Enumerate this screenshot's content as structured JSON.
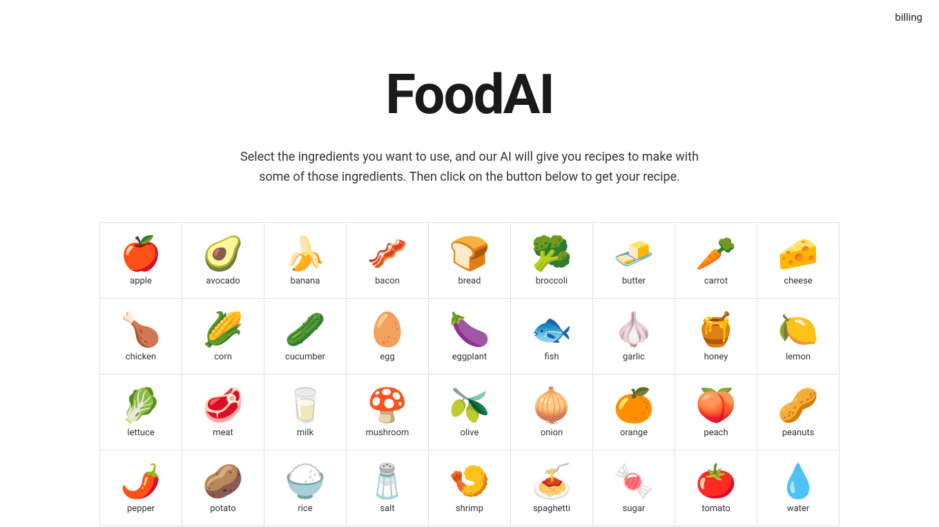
{
  "nav": {
    "billing_label": "billing"
  },
  "hero": {
    "title": "FoodAI",
    "subtitle": "Select the ingredients you want to use, and our AI will give you recipes to make with some of those ingredients. Then click on the button below to get your recipe."
  },
  "ingredients": [
    {
      "id": "apple",
      "label": "apple",
      "emoji": "🍎"
    },
    {
      "id": "avocado",
      "label": "avocado",
      "emoji": "🥑"
    },
    {
      "id": "banana",
      "label": "banana",
      "emoji": "🍌"
    },
    {
      "id": "bacon",
      "label": "bacon",
      "emoji": "🥓"
    },
    {
      "id": "bread",
      "label": "bread",
      "emoji": "🍞"
    },
    {
      "id": "broccoli",
      "label": "broccoli",
      "emoji": "🥦"
    },
    {
      "id": "butter",
      "label": "butter",
      "emoji": "🧈"
    },
    {
      "id": "carrot",
      "label": "carrot",
      "emoji": "🥕"
    },
    {
      "id": "cheese",
      "label": "cheese",
      "emoji": "🧀"
    },
    {
      "id": "chicken",
      "label": "chicken",
      "emoji": "🍗"
    },
    {
      "id": "corn",
      "label": "corn",
      "emoji": "🌽"
    },
    {
      "id": "cucumber",
      "label": "cucumber",
      "emoji": "🥒"
    },
    {
      "id": "egg",
      "label": "egg",
      "emoji": "🥚"
    },
    {
      "id": "eggplant",
      "label": "eggplant",
      "emoji": "🍆"
    },
    {
      "id": "fish",
      "label": "fish",
      "emoji": "🐟"
    },
    {
      "id": "garlic",
      "label": "garlic",
      "emoji": "🧄"
    },
    {
      "id": "honey",
      "label": "honey",
      "emoji": "🍯"
    },
    {
      "id": "lemon",
      "label": "lemon",
      "emoji": "🍋"
    },
    {
      "id": "lettuce",
      "label": "lettuce",
      "emoji": "🥬"
    },
    {
      "id": "meat",
      "label": "meat",
      "emoji": "🥩"
    },
    {
      "id": "milk",
      "label": "milk",
      "emoji": "🥛"
    },
    {
      "id": "mushroom",
      "label": "mushroom",
      "emoji": "🍄"
    },
    {
      "id": "olive",
      "label": "olive",
      "emoji": "🫒"
    },
    {
      "id": "onion",
      "label": "onion",
      "emoji": "🧅"
    },
    {
      "id": "orange",
      "label": "orange",
      "emoji": "🍊"
    },
    {
      "id": "peach",
      "label": "peach",
      "emoji": "🍑"
    },
    {
      "id": "peanuts",
      "label": "peanuts",
      "emoji": "🥜"
    },
    {
      "id": "pepper",
      "label": "pepper",
      "emoji": "🌶️"
    },
    {
      "id": "potato",
      "label": "potato",
      "emoji": "🥔"
    },
    {
      "id": "rice",
      "label": "rice",
      "emoji": "🍚"
    },
    {
      "id": "salt",
      "label": "salt",
      "emoji": "🧂"
    },
    {
      "id": "shrimp",
      "label": "shrimp",
      "emoji": "🍤"
    },
    {
      "id": "spaghetti",
      "label": "spaghetti",
      "emoji": "🍝"
    },
    {
      "id": "sugar",
      "label": "sugar",
      "emoji": "🍬"
    },
    {
      "id": "tomato",
      "label": "tomato",
      "emoji": "🍅"
    },
    {
      "id": "water",
      "label": "water",
      "emoji": "💧"
    }
  ]
}
